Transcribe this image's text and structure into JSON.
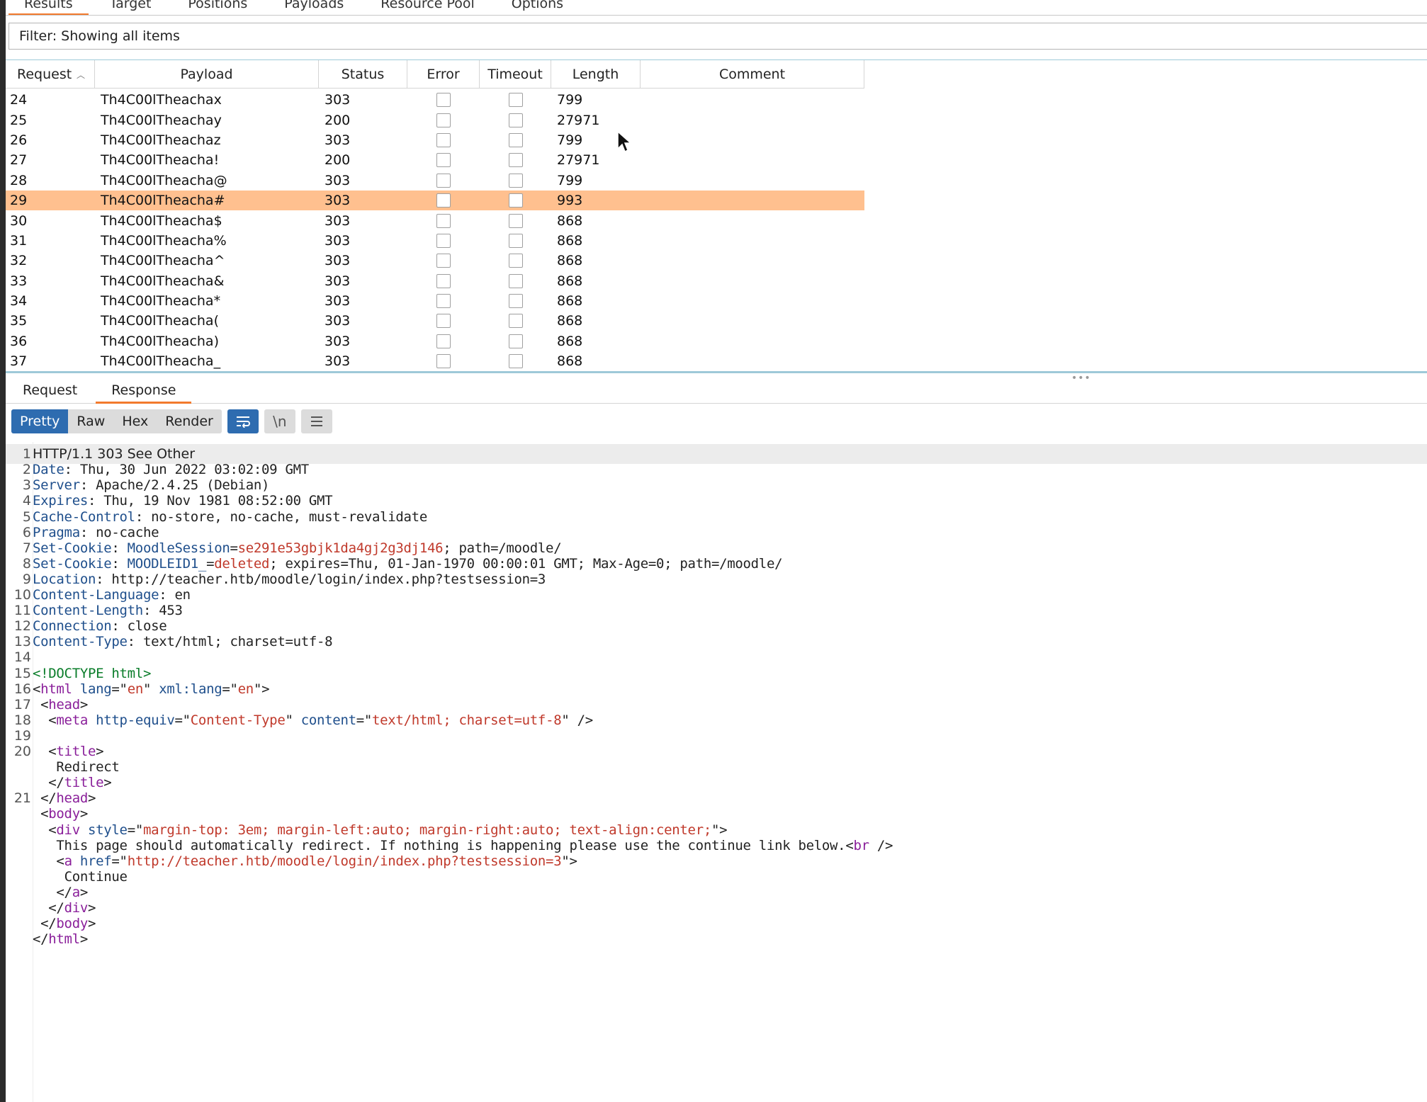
{
  "top_tabs": [
    "Results",
    "Target",
    "Positions",
    "Payloads",
    "Resource Pool",
    "Options"
  ],
  "filter_text": "Filter: Showing all items",
  "table": {
    "columns": [
      "Request",
      "Payload",
      "Status",
      "Error",
      "Timeout",
      "Length",
      "Comment"
    ],
    "rows": [
      {
        "request": "24",
        "payload": "Th4C00lTheachax",
        "status": "303",
        "length": "799"
      },
      {
        "request": "25",
        "payload": "Th4C00lTheachay",
        "status": "200",
        "length": "27971"
      },
      {
        "request": "26",
        "payload": "Th4C00lTheachaz",
        "status": "303",
        "length": "799"
      },
      {
        "request": "27",
        "payload": "Th4C00lTheacha!",
        "status": "200",
        "length": "27971"
      },
      {
        "request": "28",
        "payload": "Th4C00lTheacha@",
        "status": "303",
        "length": "799"
      },
      {
        "request": "29",
        "payload": "Th4C00lTheacha#",
        "status": "303",
        "length": "993",
        "selected": true
      },
      {
        "request": "30",
        "payload": "Th4C00lTheacha$",
        "status": "303",
        "length": "868"
      },
      {
        "request": "31",
        "payload": "Th4C00lTheacha%",
        "status": "303",
        "length": "868"
      },
      {
        "request": "32",
        "payload": "Th4C00lTheacha^",
        "status": "303",
        "length": "868"
      },
      {
        "request": "33",
        "payload": "Th4C00lTheacha&",
        "status": "303",
        "length": "868"
      },
      {
        "request": "34",
        "payload": "Th4C00lTheacha*",
        "status": "303",
        "length": "868"
      },
      {
        "request": "35",
        "payload": "Th4C00lTheacha(",
        "status": "303",
        "length": "868"
      },
      {
        "request": "36",
        "payload": "Th4C00lTheacha)",
        "status": "303",
        "length": "868"
      },
      {
        "request": "37",
        "payload": "Th4C00lTheacha_",
        "status": "303",
        "length": "868"
      }
    ]
  },
  "rr_tabs": [
    "Request",
    "Response"
  ],
  "view_modes": [
    "Pretty",
    "Raw",
    "Hex",
    "Render"
  ],
  "newline_btn": "\\n",
  "response": {
    "status_line": "HTTP/1.1 303 See Other",
    "headers": [
      {
        "k": "Date",
        "v": "Thu, 30 Jun 2022 03:02:09 GMT"
      },
      {
        "k": "Server",
        "v": "Apache/2.4.25 (Debian)"
      },
      {
        "k": "Expires",
        "v": "Thu, 19 Nov 1981 08:52:00 GMT"
      },
      {
        "k": "Cache-Control",
        "v": "no-store, no-cache, must-revalidate"
      },
      {
        "k": "Pragma",
        "v": "no-cache"
      },
      {
        "k": "Set-Cookie",
        "cookie_name": "MoodleSession",
        "cookie_value": "se291e53gbjk1da4gj2g3dj146",
        "rest": "; path=/moodle/"
      },
      {
        "k": "Set-Cookie",
        "cookie_name": "MOODLEID1_",
        "cookie_value": "deleted",
        "rest": "; expires=Thu, 01-Jan-1970 00:00:01 GMT; Max-Age=0; path=/moodle/"
      },
      {
        "k": "Location",
        "v": "http://teacher.htb/moodle/login/index.php?testsession=3"
      },
      {
        "k": "Content-Language",
        "v": "en"
      },
      {
        "k": "Content-Length",
        "v": "453"
      },
      {
        "k": "Connection",
        "v": "close"
      },
      {
        "k": "Content-Type",
        "v": "text/html; charset=utf-8"
      }
    ],
    "body": {
      "doctype": "<!DOCTYPE html>",
      "html_lang": "en",
      "xml_lang": "en",
      "meta_http_equiv": "Content-Type",
      "meta_content": "text/html; charset=utf-8",
      "title_text": "Redirect",
      "div_style": "margin-top: 3em; margin-left:auto; margin-right:auto; text-align:center;",
      "redirect_text": "This page should automatically redirect. If nothing is happening please use the continue link below.",
      "link_href": "http://teacher.htb/moodle/login/index.php?testsession=3",
      "link_text": "Continue"
    }
  },
  "colors": {
    "accent_orange": "#f27a2d",
    "selected_row": "#ffc08f",
    "active_button": "#2e6cb0",
    "header_key": "#1f4f8c",
    "string_value": "#c0392b",
    "tag": "#8a1f9a",
    "doctype": "#0a7d2a"
  }
}
